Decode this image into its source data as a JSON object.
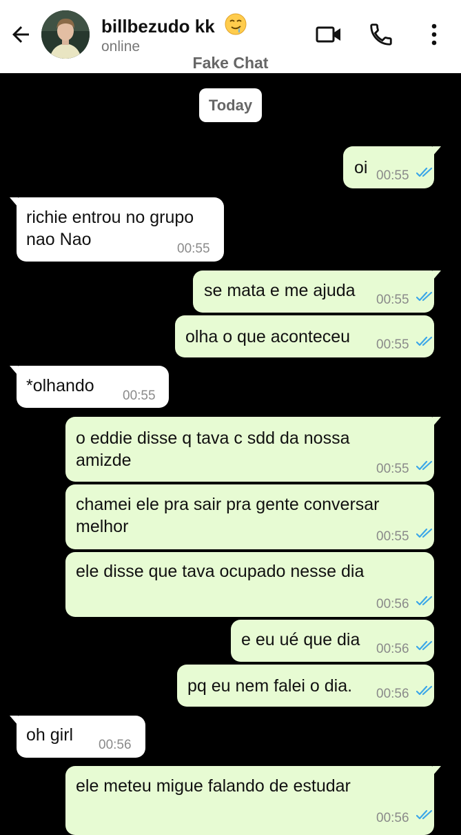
{
  "header": {
    "contact_name": "billbezudo kk",
    "status": "online",
    "app_label": "Fake Chat"
  },
  "date_divider": "Today",
  "messages": [
    {
      "dir": "out",
      "lines": [
        "oi"
      ],
      "time": "00:55",
      "read": true
    },
    {
      "dir": "in",
      "lines": [
        "richie entrou no grupo",
        "nao Nao"
      ],
      "time": "00:55"
    },
    {
      "dir": "out",
      "lines": [
        "se mata e me ajuda"
      ],
      "time": "00:55",
      "read": true
    },
    {
      "dir": "out",
      "lines": [
        "olha o que aconteceu"
      ],
      "time": "00:55",
      "read": true
    },
    {
      "dir": "in",
      "lines": [
        "*olhando"
      ],
      "time": "00:55"
    },
    {
      "dir": "out",
      "lines": [
        "o eddie disse q tava c sdd da nossa",
        "amizde"
      ],
      "time": "00:55",
      "read": true
    },
    {
      "dir": "out",
      "lines": [
        "chamei ele pra sair pra gente conversar",
        "melhor"
      ],
      "time": "00:55",
      "read": true
    },
    {
      "dir": "out",
      "lines": [
        "ele disse que tava ocupado nesse dia"
      ],
      "time": "00:56",
      "read": true
    },
    {
      "dir": "out",
      "lines": [
        "e eu ué que dia"
      ],
      "time": "00:56",
      "read": true
    },
    {
      "dir": "out",
      "lines": [
        "pq eu nem falei o dia."
      ],
      "time": "00:56",
      "read": true
    },
    {
      "dir": "in",
      "lines": [
        "oh girl"
      ],
      "time": "00:56"
    },
    {
      "dir": "out",
      "lines": [
        "ele meteu migue falando de estudar"
      ],
      "time": "00:56",
      "read": true
    }
  ],
  "colors": {
    "outgoing_bubble": "#e7fbd3",
    "incoming_bubble": "#ffffff",
    "chat_background": "#000000",
    "read_ticks": "#3ba6e8"
  },
  "icons": [
    "back-arrow-icon",
    "video-call-icon",
    "phone-icon",
    "more-options-icon",
    "drooling-face-emoji",
    "double-check-icon"
  ]
}
